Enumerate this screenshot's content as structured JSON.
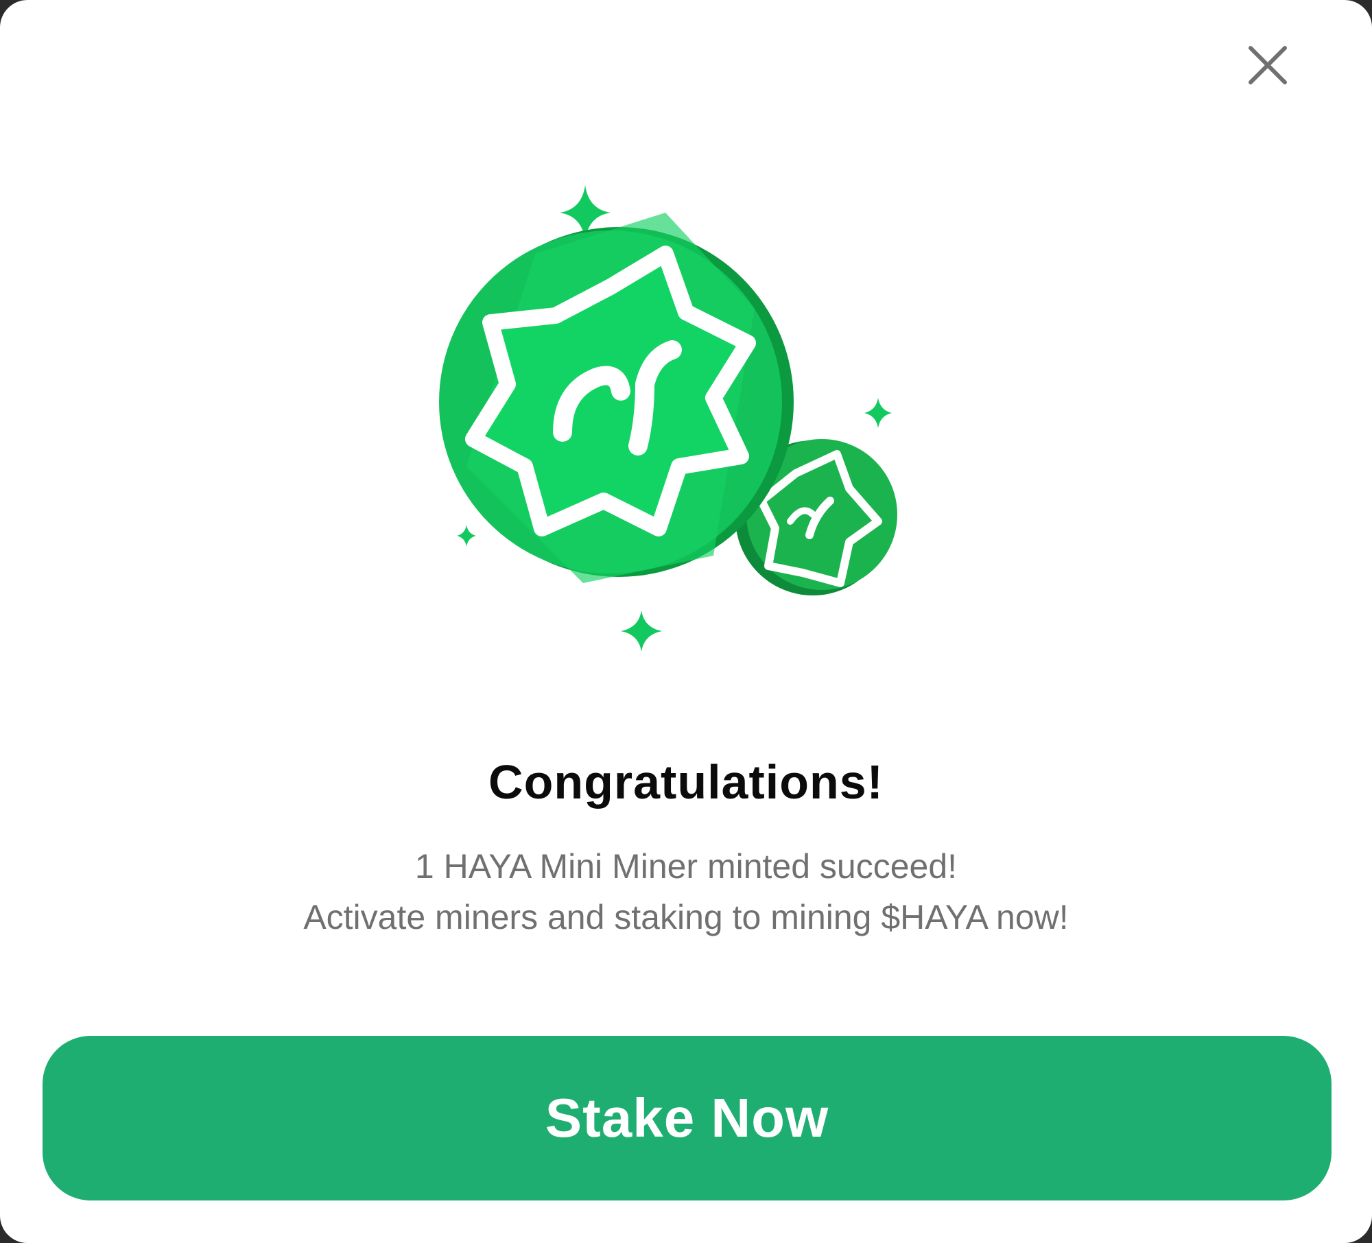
{
  "dialog": {
    "title": "Congratulations!",
    "message_line1": "1 HAYA Mini Miner minted succeed!",
    "message_line2": "Activate miners and staking to mining $HAYA now!",
    "primary_button_label": "Stake Now"
  },
  "icons": {
    "close": "close-icon",
    "illustration": "haya-coins-illustration"
  },
  "colors": {
    "accent": "#1fae71",
    "coin_light": "#12d465",
    "coin_dark": "#0a8a36",
    "title_text": "#0b0b0b",
    "body_text": "#707070"
  }
}
